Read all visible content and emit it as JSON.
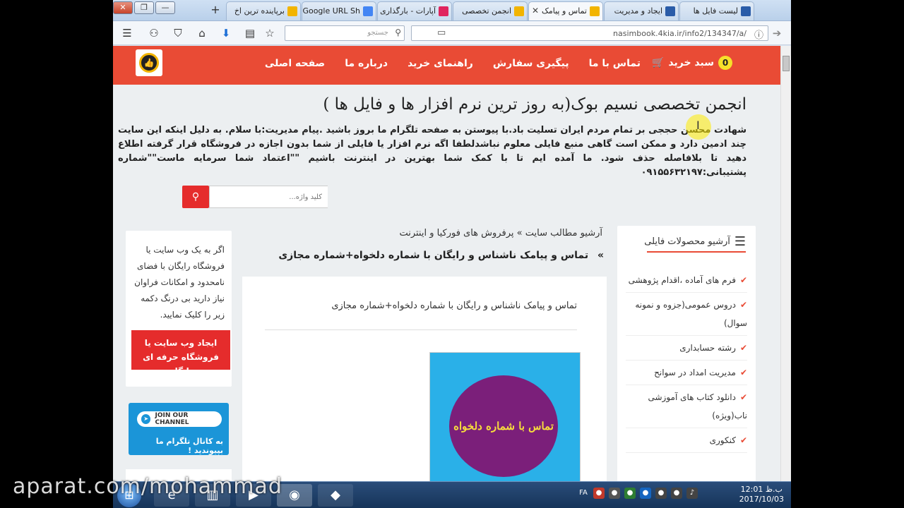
{
  "window": {
    "buttons": [
      "✕",
      "❐",
      "—"
    ],
    "new_tab": "+",
    "tabs": [
      {
        "label": "برپاینده ترین اخ",
        "active": false,
        "icon_color": "#f2b400"
      },
      {
        "label": "Google URL Sh",
        "active": false,
        "icon_color": "#4285f4"
      },
      {
        "label": "آپارات - بارگذاری",
        "active": false,
        "icon_color": "#e0245e"
      },
      {
        "label": "انجمن تخصصی",
        "active": false,
        "icon_color": "#f2b400"
      },
      {
        "label": "تماس و پیامک",
        "active": true,
        "icon_color": "#f2b400"
      },
      {
        "label": "ایجاد و مدیریت",
        "active": false,
        "icon_color": "#2a5ca8"
      },
      {
        "label": "لیست فایل ها",
        "active": false,
        "icon_color": "#2a5ca8"
      }
    ]
  },
  "navbar": {
    "search_placeholder": "جستجو",
    "url": "nasimbook.4kia.ir/info2/134347/a/"
  },
  "header": {
    "menu": [
      "صفحه اصلی",
      "درباره ما",
      "راهنمای خرید",
      "پیگیری سفارش",
      "تماس با ما"
    ],
    "cart_label": "سبد خرید",
    "cart_count": "0"
  },
  "page": {
    "title": "انجمن تخصصی نسیم بوک(به روز ترین نرم افزار ها و فایل ها )",
    "intro": "شهادت محسن حججی بر تمام مردم ایران تسلیت باد.با پیوستن به صفحه تلگرام ما بروز باشید .پیام مدیریت:با سلام. به دلیل اینکه این سایت چند ادمین دارد و ممکن است گاهی منبع فایلی معلوم نباشدلطفا اگه نرم افزار یا فایلی از شما بدون اجازه در فروشگاه قرار گرفته اطلاع دهید تا بلافاصله حذف شود. ما آمده ایم تا با کمک شما بهترین در اینترنت باشیم \"\"اعتماد شما سرمایه ماست\"\"شماره پشتیبانی:۰۹۱۵۵۶۳۲۱۹۷",
    "search_placeholder": "کلید واژه..."
  },
  "breadcrumb": {
    "root": "آرشیو مطالب سایت",
    "sep": "»",
    "current": "پرفروش های فورکیا و اینترنت"
  },
  "post": {
    "heading_prefix": "»",
    "heading": "تماس و پیامک ناشناس و رایگان با شماره دلخواه+شماره مجازی",
    "body_text": "تماس و پیامک ناشناس و رایگان با شماره دلخواه+شماره مجازی",
    "image_text": "تماس با شماره دلخواه"
  },
  "sidebar_right": {
    "title": "آرشیو محصولات فایلی",
    "items": [
      "فرم های آماده ،اقدام پژوهشی",
      "دروس عمومی(جزوه و نمونه سوال)",
      "رشته حسابداری",
      "مدیریت امداد در سوانح",
      "دانلود کتاب های آموزشی ناب(ویژه)",
      "کنکوری"
    ]
  },
  "sidebar_left": {
    "promo_text": "اگر به یک وب سایت یا فروشگاه رایگان با فضای نامحدود و امکانات فراوان نیاز دارید بی درنگ دکمه زیر را کلیک نمایید.",
    "promo_button": "ایجاد وب سایت یا فروشگاه حرفه ای رایگان",
    "telegram_pill": "JOIN OUR CHANNEL",
    "telegram_text": "به کانال تلگرام ما بپیوندید !"
  },
  "taskbar": {
    "lang": "FA",
    "time": "12:01 ب.ظ",
    "date": "2017/10/03"
  },
  "watermark": "aparat.com/mohammad"
}
